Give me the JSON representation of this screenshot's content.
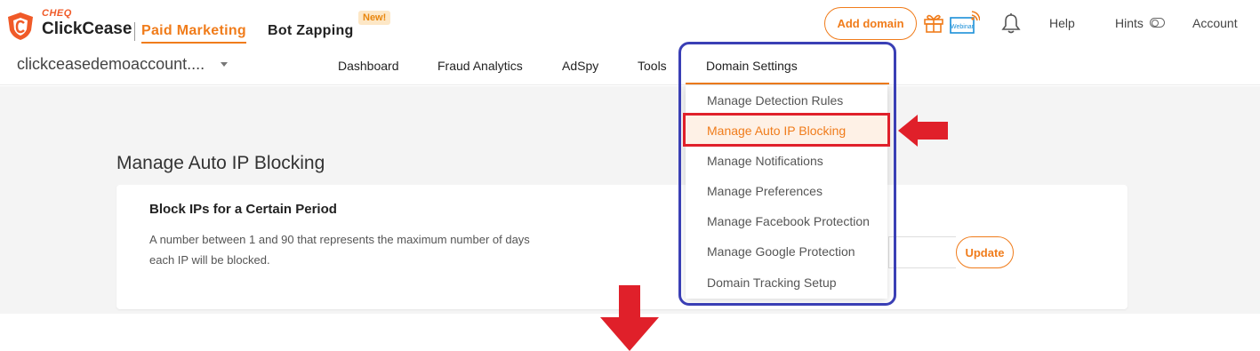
{
  "header": {
    "brand_prefix": "CHEQ",
    "brand_name": "ClickCease",
    "product_tabs": [
      "Paid Marketing",
      "Bot Zapping"
    ],
    "new_badge": "New!",
    "add_domain_label": "Add domain",
    "gift_icon": "gift-icon",
    "webinar_icon_text": "Webinar",
    "bell_icon": "bell-icon",
    "help_label": "Help",
    "hints_label": "Hints",
    "account_label": "Account",
    "accent_color": "#f07c1b"
  },
  "account_selector": {
    "value": "clickceasedemoaccount...."
  },
  "nav": {
    "items": [
      "Dashboard",
      "Fraud Analytics",
      "AdSpy",
      "Tools",
      "Domain Settings"
    ],
    "active": "Domain Settings"
  },
  "dropdown": {
    "items": [
      "Manage Detection Rules",
      "Manage Auto IP Blocking",
      "Manage Notifications",
      "Manage Preferences",
      "Manage Facebook Protection",
      "Manage Google Protection",
      "Domain Tracking Setup"
    ],
    "active": "Manage Auto IP Blocking"
  },
  "main": {
    "page_title": "Manage Auto IP Blocking",
    "card": {
      "title": "Block IPs for a Certain Period",
      "description": "A number between 1 and 90 that represents the maximum number of days each IP will be blocked.",
      "input_value": "",
      "update_label": "Update"
    }
  },
  "annotations": {
    "highlight_color": "#e0202a",
    "group_box_color": "#3a3fb5"
  }
}
